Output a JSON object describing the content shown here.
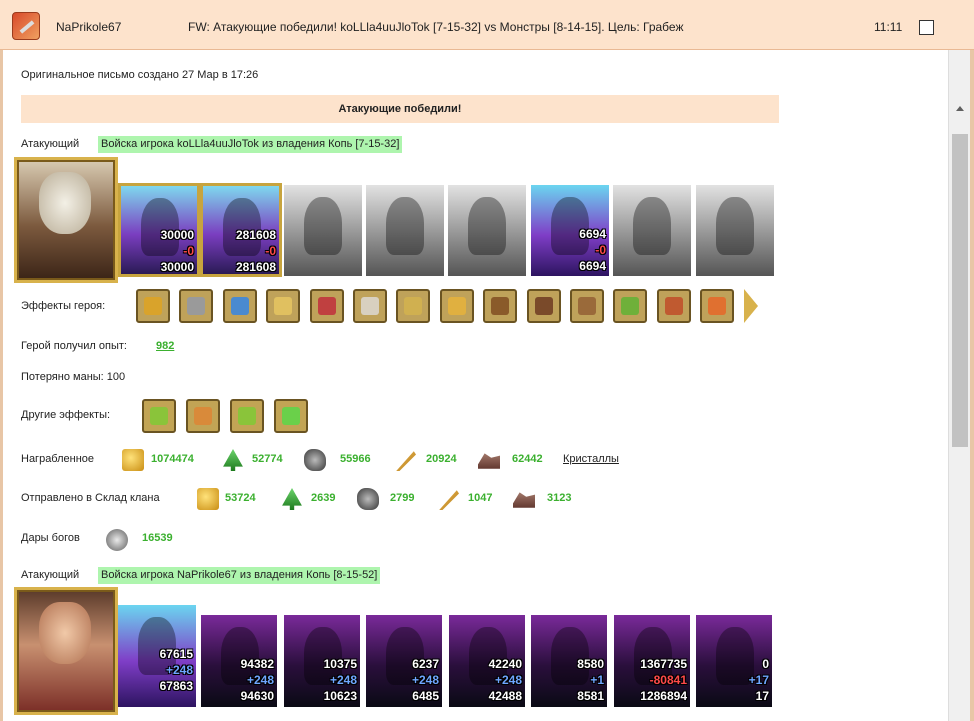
{
  "window": {
    "sender": "NaPrikole67",
    "subject": "FW: Атакующие победили! koLLla4uuJloTok [7-15-32] vs Монстры [8-14-15]. Цель: Грабеж",
    "time": "11:11"
  },
  "letter": {
    "original_created": "Оригинальное письмо создано 27 Мар в 17:26",
    "result": "Атакующие победили!"
  },
  "attacker1": {
    "label": "Атакующий",
    "army": "Войска игрока koLLla4uuJloTok из владения Копь [7-15-32]",
    "units": [
      {
        "style": "color",
        "n1": "30000",
        "n2": "-0",
        "n3": "30000"
      },
      {
        "style": "color",
        "n1": "281608",
        "n2": "-0",
        "n3": "281608"
      },
      {
        "style": "gray",
        "n1": "",
        "n2": "",
        "n3": ""
      },
      {
        "style": "gray",
        "n1": "",
        "n2": "",
        "n3": ""
      },
      {
        "style": "gray",
        "n1": "",
        "n2": "",
        "n3": ""
      },
      {
        "style": "active",
        "n1": "6694",
        "n2": "-0",
        "n3": "6694"
      },
      {
        "style": "gray",
        "n1": "",
        "n2": "",
        "n3": ""
      },
      {
        "style": "gray",
        "n1": "",
        "n2": "",
        "n3": ""
      }
    ],
    "hero_effects_label": "Эффекты героя:",
    "hero_effects": [
      "effect-gold-chest-icon",
      "effect-bandit-icon",
      "effect-orb-icon",
      "effect-crown-icon",
      "effect-shrine-icon",
      "effect-scroll-icon",
      "effect-sword-icon",
      "effect-shield-icon",
      "effect-gauntlet-icon",
      "effect-cape-icon",
      "effect-armor-icon",
      "effect-herb-icon",
      "effect-banner-icon",
      "effect-fire-icon"
    ],
    "exp_label": "Герой получил опыт:",
    "exp_value": "982",
    "mana_label": "Потеряно маны: 100",
    "other_effects_label": "Другие эффекты:",
    "other_effects": [
      "xp-icon",
      "coins-icon",
      "xp-scroll-icon",
      "potion-icon"
    ],
    "loot_label": "Награбленное",
    "loot": [
      {
        "icon": "gold-icon",
        "value": "1074474"
      },
      {
        "icon": "wood-icon",
        "value": "52774"
      },
      {
        "icon": "ore-icon",
        "value": "55966"
      },
      {
        "icon": "grain-icon",
        "value": "20924"
      },
      {
        "icon": "crystal-ore-icon",
        "value": "62442"
      }
    ],
    "crystals_link": "Кристаллы",
    "clan_label": "Отправлено в Склад клана",
    "clan": [
      {
        "icon": "gold-icon",
        "value": "53724"
      },
      {
        "icon": "wood-icon",
        "value": "2639"
      },
      {
        "icon": "ore-icon",
        "value": "2799"
      },
      {
        "icon": "grain-icon",
        "value": "1047"
      },
      {
        "icon": "crystal-ore-icon",
        "value": "3123"
      }
    ],
    "gifts_label": "Дары богов",
    "gifts_value": "16539"
  },
  "attacker2": {
    "label": "Атакующий",
    "army": "Войска игрока NaPrikole67 из владения Копь [8-15-52]",
    "units": [
      {
        "n1": "67615",
        "n2": "+248",
        "n3": "67863"
      },
      {
        "n1": "94382",
        "n2": "+248",
        "n3": "94630"
      },
      {
        "n1": "10375",
        "n2": "+248",
        "n3": "10623"
      },
      {
        "n1": "6237",
        "n2": "+248",
        "n3": "6485"
      },
      {
        "n1": "42240",
        "n2": "+248",
        "n3": "42488"
      },
      {
        "n1": "8580",
        "n2": "+1",
        "n3": "8581"
      },
      {
        "n1": "1367735",
        "n2": "-80841",
        "n3": "1286894"
      },
      {
        "n1": "0",
        "n2": "+17",
        "n3": "17"
      }
    ]
  }
}
